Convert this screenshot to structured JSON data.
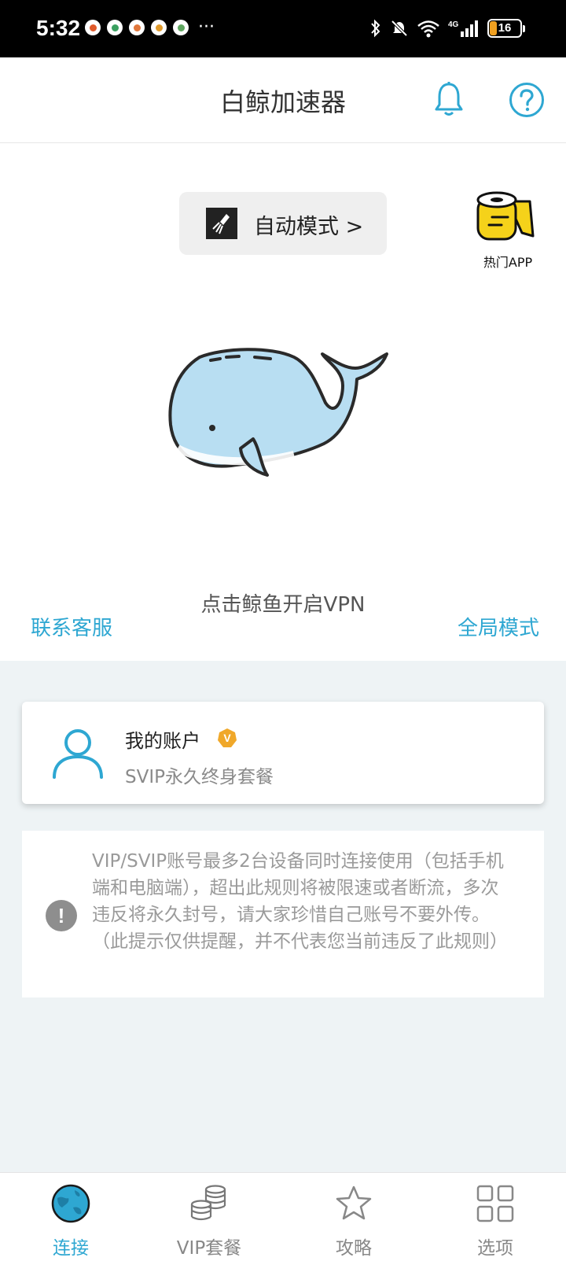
{
  "status_bar": {
    "time": "5:32",
    "battery": "16",
    "network": "4G"
  },
  "header": {
    "title": "白鲸加速器"
  },
  "mode": {
    "label": "自动模式 >"
  },
  "hot_app": {
    "label": "热门APP"
  },
  "connect": {
    "hint": "点击鲸鱼开启VPN"
  },
  "links": {
    "support": "联系客服",
    "global_mode": "全局模式"
  },
  "account": {
    "title": "我的账户",
    "plan": "SVIP永久终身套餐",
    "badge": "V"
  },
  "notice": {
    "text": "VIP/SVIP账号最多2台设备同时连接使用（包括手机端和电脑端），超出此规则将被限速或者断流，多次违反将永久封号，请大家珍惜自己账号不要外传。（此提示仅供提醒，并不代表您当前违反了此规则）"
  },
  "tabs": [
    {
      "label": "连接",
      "active": true
    },
    {
      "label": "VIP套餐",
      "active": false
    },
    {
      "label": "攻略",
      "active": false
    },
    {
      "label": "选项",
      "active": false
    }
  ],
  "colors": {
    "accent": "#2ea7d2",
    "whale": "#b8def2"
  }
}
